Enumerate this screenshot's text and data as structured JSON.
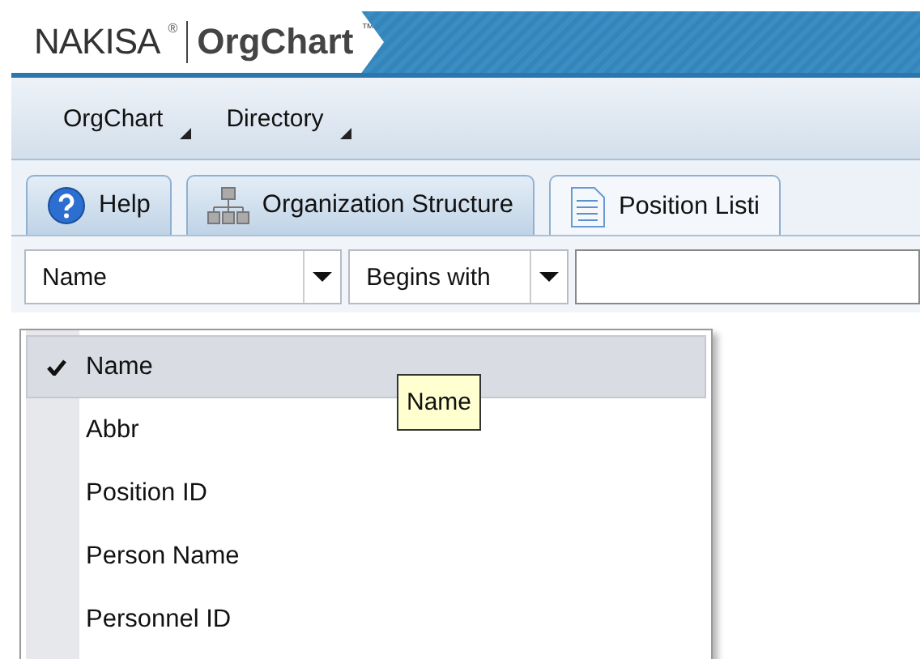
{
  "header": {
    "brand": "NAKISA",
    "brand_mark": "®",
    "product": "OrgChart",
    "product_mark": "™"
  },
  "menu": [
    {
      "label": "OrgChart"
    },
    {
      "label": "Directory"
    }
  ],
  "tabs": [
    {
      "label": "Help",
      "selected": false
    },
    {
      "label": "Organization Structure",
      "selected": false
    },
    {
      "label": "Position Listi",
      "selected": true
    }
  ],
  "filter": {
    "field": "Name",
    "operator": "Begins with"
  },
  "field_options": [
    {
      "label": "Name",
      "selected": true
    },
    {
      "label": "Abbr",
      "selected": false
    },
    {
      "label": "Position ID",
      "selected": false
    },
    {
      "label": "Person Name",
      "selected": false
    },
    {
      "label": "Personnel ID",
      "selected": false
    }
  ],
  "tooltip": "Name"
}
